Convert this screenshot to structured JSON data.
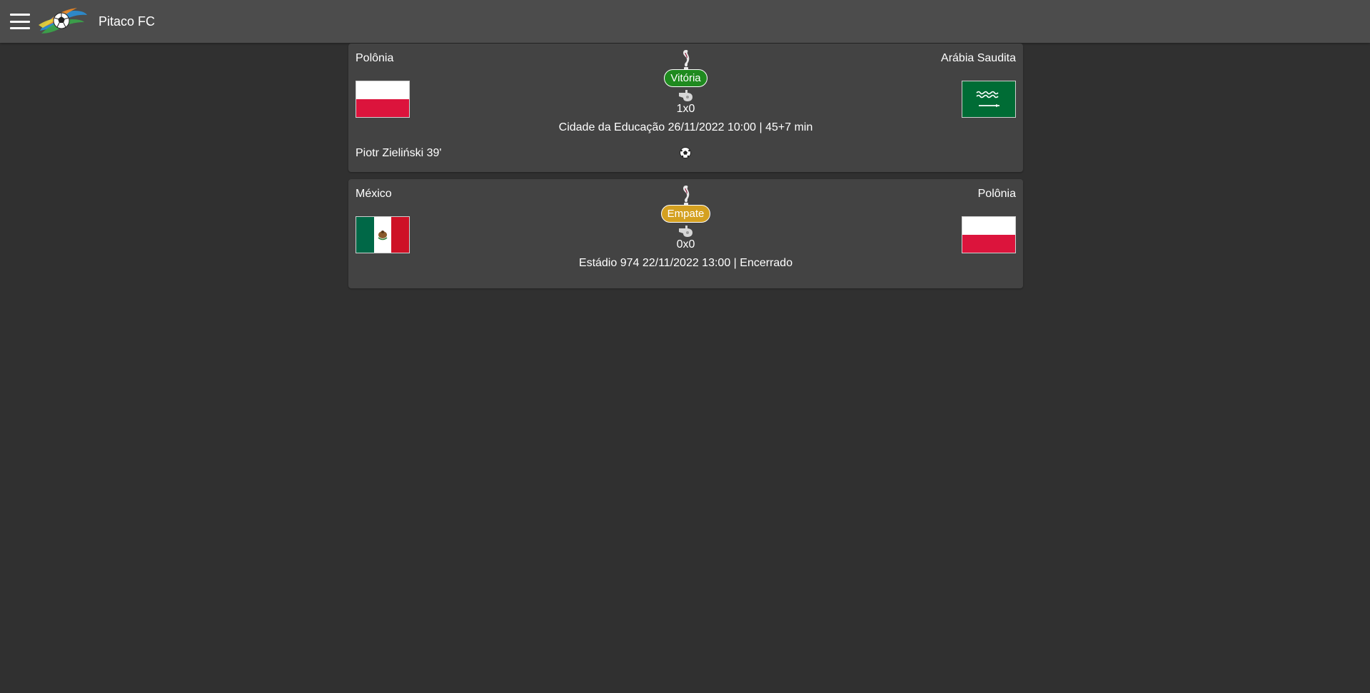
{
  "app": {
    "title": "Pitaco FC"
  },
  "matches": [
    {
      "home_team": "Polônia",
      "away_team": "Arábia Saudita",
      "home_flag": "flag-poland-icon",
      "away_flag": "flag-saudi-arabia-icon",
      "result": "Vitória",
      "result_color": "#1f8a1f",
      "score": "1x0",
      "venue": "Cidade da Educação 26/11/2022 10:00",
      "separator": "|",
      "status": "45+7 min",
      "scorers": [
        "Piotr Zieliński 39'"
      ]
    },
    {
      "home_team": "México",
      "away_team": "Polônia",
      "home_flag": "flag-mexico-icon",
      "away_flag": "flag-poland-icon",
      "result": "Empate",
      "result_color": "#d4a020",
      "score": "0x0",
      "venue": "Estádio 974 22/11/2022 13:00",
      "separator": "|",
      "status": "Encerrado"
    }
  ],
  "colors": {
    "background": "#303030",
    "topbar": "#4c4c4c",
    "card": "#434343"
  }
}
